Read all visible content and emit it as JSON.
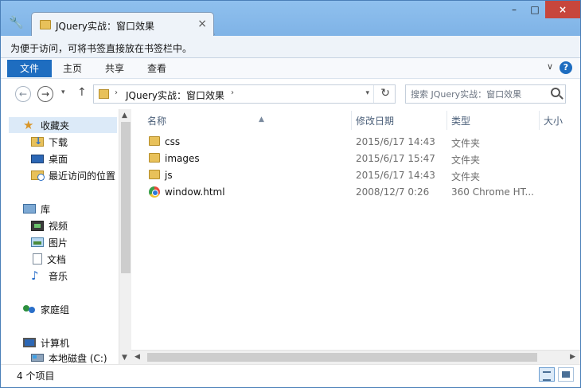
{
  "tab": {
    "title": "JQuery实战：窗口效果",
    "close": "×"
  },
  "window_controls": {
    "minimize": "–",
    "maximize": "□",
    "close": "×"
  },
  "bookmark_hint": "为便于访问，可将书签直接放在书签栏中。",
  "ribbon": {
    "file": "文件",
    "tabs": [
      "主页",
      "共享",
      "查看"
    ],
    "expand": "∨",
    "help": "?"
  },
  "nav": {
    "back": "←",
    "forward": "→",
    "dropdown": "▾",
    "up": "↑",
    "address": "JQuery实战：窗口效果",
    "address_sep": "›",
    "refresh": "↻",
    "search_placeholder": "搜索 JQuery实战：窗口效果"
  },
  "sidebar": {
    "items": [
      {
        "label": "收藏夹",
        "icon": "star-icon"
      },
      {
        "label": "下载",
        "icon": "downloads-folder-icon"
      },
      {
        "label": "桌面",
        "icon": "desktop-icon"
      },
      {
        "label": "最近访问的位置",
        "icon": "recent-places-icon"
      },
      {
        "label": "库",
        "icon": "library-icon"
      },
      {
        "label": "视频",
        "icon": "videos-icon"
      },
      {
        "label": "图片",
        "icon": "pictures-icon"
      },
      {
        "label": "文档",
        "icon": "documents-icon"
      },
      {
        "label": "音乐",
        "icon": "music-icon"
      },
      {
        "label": "家庭组",
        "icon": "homegroup-icon"
      },
      {
        "label": "计算机",
        "icon": "computer-icon"
      },
      {
        "label": "本地磁盘 (C:)",
        "icon": "local-disk-icon"
      }
    ]
  },
  "columns": {
    "name": "名称",
    "date": "修改日期",
    "type": "类型",
    "size": "大小"
  },
  "files": [
    {
      "name": "css",
      "date": "2015/6/17 14:43",
      "type": "文件夹",
      "icon": "folder-icon"
    },
    {
      "name": "images",
      "date": "2015/6/17 15:47",
      "type": "文件夹",
      "icon": "folder-icon"
    },
    {
      "name": "js",
      "date": "2015/6/17 14:43",
      "type": "文件夹",
      "icon": "folder-icon"
    },
    {
      "name": "window.html",
      "date": "2008/12/7 0:26",
      "type": "360 Chrome HT...",
      "icon": "chrome-html-icon"
    }
  ],
  "status": {
    "count": "4 个项目"
  }
}
